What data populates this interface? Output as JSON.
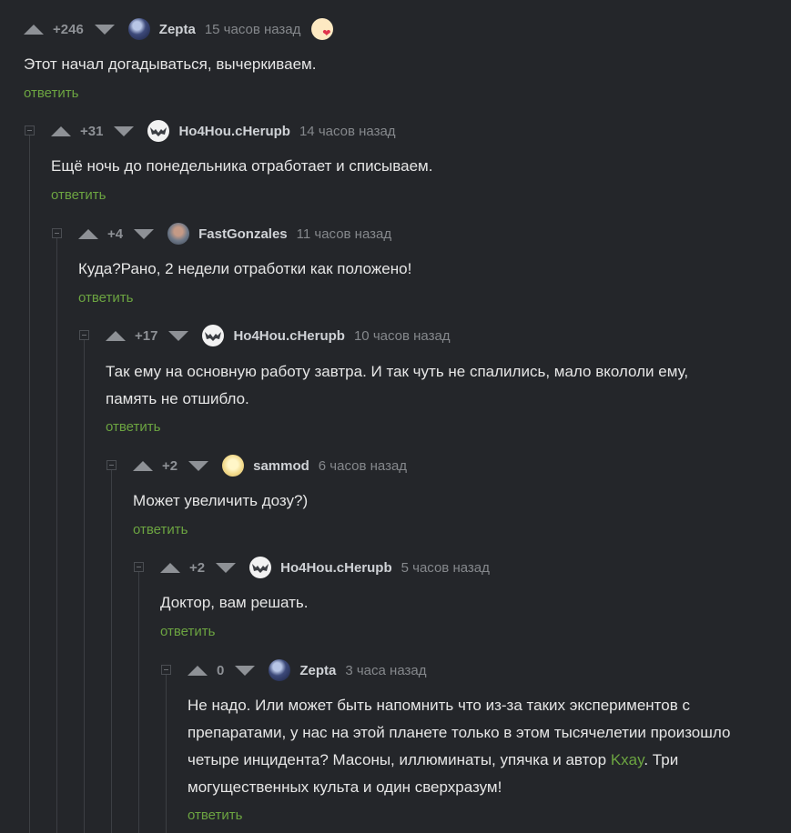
{
  "comments": [
    {
      "rating": "+246",
      "user": "Zepta",
      "time": "15 часов назад",
      "text": "Этот начал догадываться, вычеркиваем.",
      "reply": "ответить",
      "avatar": "zepta-avatar-icon",
      "has_badge": true
    },
    {
      "rating": "+31",
      "user": "Ho4Hou.cHerupb",
      "time": "14 часов назад",
      "text": "Ещё ночь до понедельника отработает и списываем.",
      "reply": "ответить",
      "avatar": "bat-avatar-icon"
    },
    {
      "rating": "+4",
      "user": "FastGonzales",
      "time": "11 часов назад",
      "text": "Куда?Рано, 2 недели отработки как положено!",
      "reply": "ответить",
      "avatar": "fastgonzales-avatar-icon"
    },
    {
      "rating": "+17",
      "user": "Ho4Hou.cHerupb",
      "time": "10 часов назад",
      "text_line1": "Так ему на основную работу завтра. И так чуть не спалились, мало вкололи ему,",
      "text_line2": "память не отшибло.",
      "reply": "ответить",
      "avatar": "bat-avatar-icon"
    },
    {
      "rating": "+2",
      "user": "sammod",
      "time": "6 часов назад",
      "text": "Может увеличить дозу?)",
      "reply": "ответить",
      "avatar": "sammod-avatar-icon"
    },
    {
      "rating": "+2",
      "user": "Ho4Hou.cHerupb",
      "time": "5 часов назад",
      "text": "Доктор, вам решать.",
      "reply": "ответить",
      "avatar": "bat-avatar-icon"
    },
    {
      "rating": "0",
      "user": "Zepta",
      "time": "3 часа назад",
      "text_line1": "Не надо. Или может быть напомнить что из-за таких экспериментов с",
      "text_line2": "препаратами, у нас на этой планете только в этом тысячелетии произошло",
      "text_line3_pre": "четыре инцидента? Масоны, иллюминаты, упячка и автор ",
      "text_line3_link": "Kxay",
      "text_line3_post": ". Три",
      "text_line4": "могущественных культа и один сверхразум!",
      "reply": "ответить",
      "avatar": "zepta-avatar-icon"
    }
  ],
  "colors": {
    "background": "#24262a",
    "link": "#6ca441",
    "muted": "#8e9196"
  }
}
